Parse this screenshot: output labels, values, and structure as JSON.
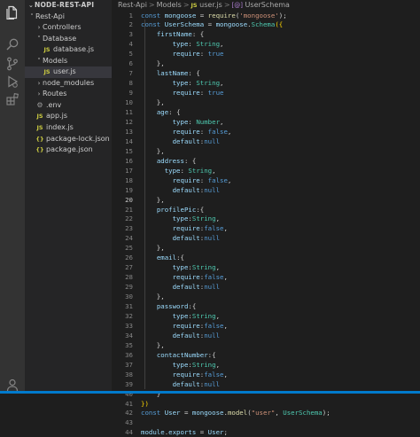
{
  "activity_bar": {
    "icons": [
      "files-icon",
      "search-icon",
      "source-control-icon",
      "run-debug-icon",
      "extensions-icon"
    ],
    "account_icon": "account-icon"
  },
  "explorer": {
    "header": "NODE-REST-API",
    "tree": [
      {
        "label": "Rest-Api",
        "type": "folder",
        "expanded": true,
        "depth": 0
      },
      {
        "label": "Controllers",
        "type": "folder",
        "expanded": false,
        "depth": 1
      },
      {
        "label": "Database",
        "type": "folder",
        "expanded": true,
        "depth": 1
      },
      {
        "label": "database.js",
        "type": "js",
        "depth": 2
      },
      {
        "label": "Models",
        "type": "folder",
        "expanded": true,
        "depth": 1
      },
      {
        "label": "user.js",
        "type": "js",
        "depth": 2,
        "selected": true
      },
      {
        "label": "node_modules",
        "type": "folder",
        "expanded": false,
        "depth": 1
      },
      {
        "label": "Routes",
        "type": "folder",
        "expanded": false,
        "depth": 1
      },
      {
        "label": ".env",
        "type": "env",
        "depth": 1
      },
      {
        "label": "app.js",
        "type": "js",
        "depth": 1
      },
      {
        "label": "index.js",
        "type": "js",
        "depth": 1
      },
      {
        "label": "package-lock.json",
        "type": "json",
        "depth": 1
      },
      {
        "label": "package.json",
        "type": "json",
        "depth": 1
      }
    ]
  },
  "breadcrumb": {
    "items": [
      "Rest-Api",
      "Models",
      "user.js",
      "UserSchema"
    ],
    "separator": ">",
    "symbol_icon": "[@]"
  },
  "editor": {
    "active_line": 20,
    "lines": [
      [
        [
          "k",
          "const "
        ],
        [
          "v",
          "mongoose"
        ],
        [
          "p",
          " = "
        ],
        [
          "f",
          "require"
        ],
        [
          "p",
          "("
        ],
        [
          "s",
          "'mongoose'"
        ],
        [
          "p",
          ");"
        ]
      ],
      [
        [
          "k",
          "const "
        ],
        [
          "v",
          "UserSchema"
        ],
        [
          "p",
          " = "
        ],
        [
          "v",
          "mongoose"
        ],
        [
          "p",
          "."
        ],
        [
          "t",
          "Schema"
        ],
        [
          "bracket",
          "({"
        ]
      ],
      [
        [
          "p",
          "    "
        ],
        [
          "v",
          "firstName"
        ],
        [
          "p",
          ": {"
        ]
      ],
      [
        [
          "p",
          "        "
        ],
        [
          "v",
          "type"
        ],
        [
          "p",
          ": "
        ],
        [
          "t",
          "String"
        ],
        [
          "p",
          ","
        ]
      ],
      [
        [
          "p",
          "        "
        ],
        [
          "v",
          "require"
        ],
        [
          "p",
          ": "
        ],
        [
          "k",
          "true"
        ]
      ],
      [
        [
          "p",
          "    },"
        ]
      ],
      [
        [
          "p",
          "    "
        ],
        [
          "v",
          "lastName"
        ],
        [
          "p",
          ": {"
        ]
      ],
      [
        [
          "p",
          "        "
        ],
        [
          "v",
          "type"
        ],
        [
          "p",
          ": "
        ],
        [
          "t",
          "String"
        ],
        [
          "p",
          ","
        ]
      ],
      [
        [
          "p",
          "        "
        ],
        [
          "v",
          "require"
        ],
        [
          "p",
          ": "
        ],
        [
          "k",
          "true"
        ]
      ],
      [
        [
          "p",
          "    },"
        ]
      ],
      [
        [
          "p",
          "    "
        ],
        [
          "v",
          "age"
        ],
        [
          "p",
          ": {"
        ]
      ],
      [
        [
          "p",
          "        "
        ],
        [
          "v",
          "type"
        ],
        [
          "p",
          ": "
        ],
        [
          "t",
          "Number"
        ],
        [
          "p",
          ","
        ]
      ],
      [
        [
          "p",
          "        "
        ],
        [
          "v",
          "require"
        ],
        [
          "p",
          ": "
        ],
        [
          "k",
          "false"
        ],
        [
          "p",
          ","
        ]
      ],
      [
        [
          "p",
          "        "
        ],
        [
          "v",
          "default"
        ],
        [
          "p",
          ":"
        ],
        [
          "k",
          "null"
        ]
      ],
      [
        [
          "p",
          "    },"
        ]
      ],
      [
        [
          "p",
          "    "
        ],
        [
          "v",
          "address"
        ],
        [
          "p",
          ": {"
        ]
      ],
      [
        [
          "p",
          "      "
        ],
        [
          "v",
          "type"
        ],
        [
          "p",
          ": "
        ],
        [
          "t",
          "String"
        ],
        [
          "p",
          ","
        ]
      ],
      [
        [
          "p",
          "        "
        ],
        [
          "v",
          "require"
        ],
        [
          "p",
          ": "
        ],
        [
          "k",
          "false"
        ],
        [
          "p",
          ","
        ]
      ],
      [
        [
          "p",
          "        "
        ],
        [
          "v",
          "default"
        ],
        [
          "p",
          ":"
        ],
        [
          "k",
          "null"
        ]
      ],
      [
        [
          "p",
          "    },"
        ]
      ],
      [
        [
          "p",
          "    "
        ],
        [
          "v",
          "profilePic"
        ],
        [
          "p",
          ":{"
        ]
      ],
      [
        [
          "p",
          "        "
        ],
        [
          "v",
          "type"
        ],
        [
          "p",
          ":"
        ],
        [
          "t",
          "String"
        ],
        [
          "p",
          ","
        ]
      ],
      [
        [
          "p",
          "        "
        ],
        [
          "v",
          "require"
        ],
        [
          "p",
          ":"
        ],
        [
          "k",
          "false"
        ],
        [
          "p",
          ","
        ]
      ],
      [
        [
          "p",
          "        "
        ],
        [
          "v",
          "default"
        ],
        [
          "p",
          ":"
        ],
        [
          "k",
          "null"
        ]
      ],
      [
        [
          "p",
          "    },"
        ]
      ],
      [
        [
          "p",
          "    "
        ],
        [
          "v",
          "email"
        ],
        [
          "p",
          ":{"
        ]
      ],
      [
        [
          "p",
          "        "
        ],
        [
          "v",
          "type"
        ],
        [
          "p",
          ":"
        ],
        [
          "t",
          "String"
        ],
        [
          "p",
          ","
        ]
      ],
      [
        [
          "p",
          "        "
        ],
        [
          "v",
          "require"
        ],
        [
          "p",
          ":"
        ],
        [
          "k",
          "false"
        ],
        [
          "p",
          ","
        ]
      ],
      [
        [
          "p",
          "        "
        ],
        [
          "v",
          "default"
        ],
        [
          "p",
          ":"
        ],
        [
          "k",
          "null"
        ]
      ],
      [
        [
          "p",
          "    },"
        ]
      ],
      [
        [
          "p",
          "    "
        ],
        [
          "v",
          "password"
        ],
        [
          "p",
          ":{"
        ]
      ],
      [
        [
          "p",
          "        "
        ],
        [
          "v",
          "type"
        ],
        [
          "p",
          ":"
        ],
        [
          "t",
          "String"
        ],
        [
          "p",
          ","
        ]
      ],
      [
        [
          "p",
          "        "
        ],
        [
          "v",
          "require"
        ],
        [
          "p",
          ":"
        ],
        [
          "k",
          "false"
        ],
        [
          "p",
          ","
        ]
      ],
      [
        [
          "p",
          "        "
        ],
        [
          "v",
          "default"
        ],
        [
          "p",
          ":"
        ],
        [
          "k",
          "null"
        ]
      ],
      [
        [
          "p",
          "    },"
        ]
      ],
      [
        [
          "p",
          "    "
        ],
        [
          "v",
          "contactNumber"
        ],
        [
          "p",
          ":{"
        ]
      ],
      [
        [
          "p",
          "        "
        ],
        [
          "v",
          "type"
        ],
        [
          "p",
          ":"
        ],
        [
          "t",
          "String"
        ],
        [
          "p",
          ","
        ]
      ],
      [
        [
          "p",
          "        "
        ],
        [
          "v",
          "require"
        ],
        [
          "p",
          ":"
        ],
        [
          "k",
          "false"
        ],
        [
          "p",
          ","
        ]
      ],
      [
        [
          "p",
          "        "
        ],
        [
          "v",
          "default"
        ],
        [
          "p",
          ":"
        ],
        [
          "k",
          "null"
        ]
      ],
      [
        [
          "p",
          "    }"
        ]
      ],
      [
        [
          "bracket",
          "})"
        ]
      ],
      [
        [
          "k",
          "const "
        ],
        [
          "v",
          "User"
        ],
        [
          "p",
          " = "
        ],
        [
          "v",
          "mongoose"
        ],
        [
          "p",
          "."
        ],
        [
          "f",
          "model"
        ],
        [
          "p",
          "("
        ],
        [
          "s",
          "\"user\""
        ],
        [
          "p",
          ", "
        ],
        [
          "t",
          "UserSchema"
        ],
        [
          "p",
          ");"
        ]
      ],
      [
        [
          "p",
          ""
        ]
      ],
      [
        [
          "v",
          "module"
        ],
        [
          "p",
          "."
        ],
        [
          "v",
          "exports"
        ],
        [
          "p",
          " = "
        ],
        [
          "v",
          "User"
        ],
        [
          "p",
          ";"
        ]
      ]
    ]
  },
  "colors": {
    "activity_bar": "#333333",
    "sidebar": "#252526",
    "editor": "#1e1e1e",
    "keyword": "#569cd6",
    "variable": "#9cdcfe",
    "function": "#dcdcaa",
    "string": "#ce9178",
    "type": "#4ec9b0"
  }
}
